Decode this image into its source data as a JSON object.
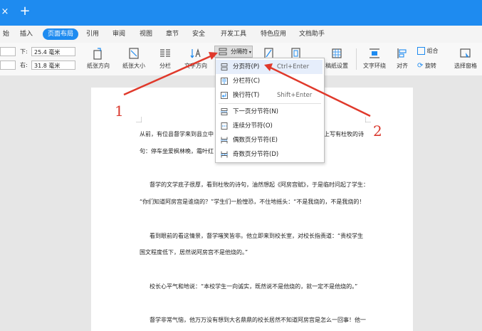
{
  "titlebar": {
    "close_glyph": "×",
    "add_glyph": "+"
  },
  "menu": [
    {
      "label": "始",
      "active": false
    },
    {
      "label": "插入",
      "active": false
    },
    {
      "label": "页面布局",
      "active": true
    },
    {
      "label": "引用",
      "active": false
    },
    {
      "label": "审阅",
      "active": false
    },
    {
      "label": "视图",
      "active": false
    },
    {
      "label": "章节",
      "active": false
    },
    {
      "label": "安全",
      "active": false
    },
    {
      "label": "开发工具",
      "active": false
    },
    {
      "label": "特色应用",
      "active": false
    },
    {
      "label": "文档助手",
      "active": false
    }
  ],
  "margins": {
    "bottom_label": "下:",
    "bottom_value": "25.4 毫米",
    "right_label": "右:",
    "right_value": "31.8 毫米"
  },
  "ribbon": {
    "orientation": "纸张方向",
    "size": "纸张大小",
    "columns": "分栏",
    "text_direction": "文字方向",
    "breaks": "分隔符",
    "paper_setup": "稿纸设置",
    "wrap": "文字环绕",
    "align": "对齐",
    "group": "组合",
    "rotate": "旋转",
    "selection_pane": "选择窗格"
  },
  "dropdown": {
    "items": [
      {
        "icon": "page-break-icon",
        "label": "分页符(P)",
        "shortcut": "Ctrl+Enter",
        "highlight": true
      },
      {
        "icon": "column-break-icon",
        "label": "分栏符(C)",
        "shortcut": ""
      },
      {
        "icon": "line-break-icon",
        "label": "换行符(T)",
        "shortcut": "Shift+Enter"
      },
      {
        "icon": "next-page-section-icon",
        "label": "下一页分节符(N)",
        "shortcut": ""
      },
      {
        "icon": "continuous-section-icon",
        "label": "连续分节符(O)",
        "shortcut": ""
      },
      {
        "icon": "even-page-section-icon",
        "label": "偶数页分节符(E)",
        "shortcut": ""
      },
      {
        "icon": "odd-page-section-icon",
        "label": "奇数页分节符(D)",
        "shortcut": ""
      }
    ]
  },
  "annotations": {
    "one": "1",
    "two": "2",
    "color": "#e0392b"
  },
  "document": {
    "lines": [
      "从前，有位县督学来到县立中",
      "上写有杜牧的诗",
      "句：停车坐爱枫林晚，霜叶红",
      "督学的文学底子很厚，看到杜牧的诗句，油然想起《阿房宫赋》，于是临时问起了学生：",
      "“你们知道阿房宫是谁烧的？”学生们一脸惶恐，不住地摇头：“不是我烧的，不是我烧的！",
      "看到眼前的看这情景，督学嗤笑皆非。他立即来到校长室，对校长指责道：“贵校学生",
      "国文程度低下，居然说阿房宫不是他烧的。”",
      "校长心平气和地说：“本校学生一向诚实，既然说不是他烧的，就一定不是他烧的。”",
      "督学非常气恼，他万万没有想到大名鼎鼎的校长居然不知道阿房宫是怎么一回事！他一"
    ]
  },
  "colors": {
    "accent": "#1e8bf0",
    "highlight": "#e6eefb"
  }
}
